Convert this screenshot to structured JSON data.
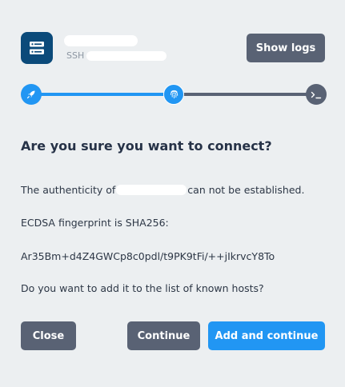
{
  "header": {
    "host_icon": "server-icon",
    "host_type": "SSH",
    "show_logs_label": "Show logs"
  },
  "stepper": {
    "steps": [
      {
        "icon": "rocket-icon",
        "state": "done"
      },
      {
        "icon": "fingerprint-icon",
        "state": "active"
      },
      {
        "icon": "terminal-icon",
        "state": "pending"
      }
    ],
    "completed_fraction": 0.5
  },
  "dialog": {
    "title": "Are you sure you want to connect?",
    "authenticity_prefix": "The authenticity of",
    "authenticity_suffix": "can not be established.",
    "fingerprint_label": "ECDSA fingerprint is SHA256:",
    "fingerprint_value": "Ar35Bm+d4Z4GWCp8c0pdl/t9PK9tFi/++jIkrvcY8To",
    "question": "Do you want to add it to the list of known hosts?"
  },
  "actions": {
    "close_label": "Close",
    "continue_label": "Continue",
    "add_continue_label": "Add and continue"
  },
  "colors": {
    "accent": "#2196f3",
    "secondary": "#596274",
    "background": "#eceff1",
    "host_icon_bg": "#0b4a7a"
  }
}
